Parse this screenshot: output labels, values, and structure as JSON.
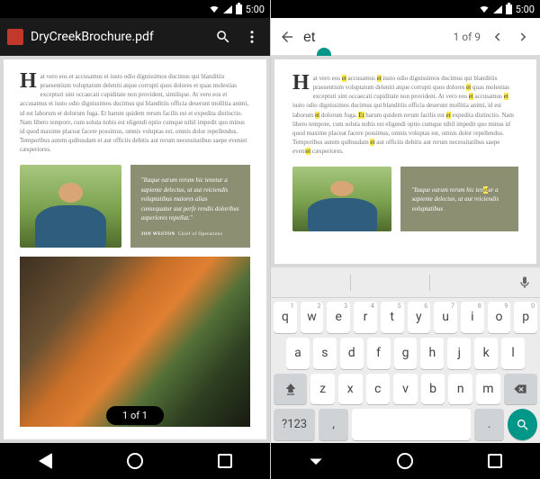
{
  "status": {
    "time": "5:00"
  },
  "left": {
    "appbar": {
      "title": "DryCreekBrochure.pdf",
      "pdf_icon_text": ""
    },
    "doc": {
      "dropcap": "H",
      "paragraph": "at vero eos et accusamus et iusto odio dignissimos ducimus qui blanditiis praesentium voluptatum deleniti atque corrupti quos dolores et quas molestias excepturi sint occaecati cupiditate non provident, similique. At vero eos et accusamus et iusto odio dignissimos ducimus qui blanditiis officia deserunt mollitia animi, id est laborum et dolorum fuga. Et harum quidem rerum facilis est et expedita distinctio. Nam libero tempore, cum soluta nobis est eligendi optio cumque nihil impedit quo minus id quod maxime placeat facere possimus, omnis voluptas est, omnis dolor repellendus. Temporibus autem quibusdam et aut officiis debitis aut rerum necessitatibus saepe eveniet cæsperiores.",
      "quote": "\"Itaque earum rerum hic tenetur a sapiente delectus, ut aut reiciendis voluptatibus maiores alias consequatur aut perfe rendis doloribus asperiores repellat.\"",
      "quote_by": "JON WESTON",
      "quote_role": "Chief of Operations"
    },
    "page_indicator": "1 of 1"
  },
  "right": {
    "search": {
      "value": "et",
      "count": "1 of 9"
    },
    "doc": {
      "dropcap": "H",
      "segments": [
        {
          "t": "at vero eos ",
          "h": false
        },
        {
          "t": "et",
          "h": true
        },
        {
          "t": " accusamus ",
          "h": false
        },
        {
          "t": "et",
          "h": true
        },
        {
          "t": " iusto odio dignissimos ducimus qui blanditiis praesentium voluptatum deleniti atque corrupti quos dolores ",
          "h": false
        },
        {
          "t": "et",
          "h": true
        },
        {
          "t": " quas molestias excepturi sint occaecati cupiditate non provident. At vero eos ",
          "h": false
        },
        {
          "t": "et",
          "h": true
        },
        {
          "t": " accusamus ",
          "h": false
        },
        {
          "t": "et",
          "h": true
        },
        {
          "t": " iusto odio dignissimos ducimus qui blanditiis officia deserunt mollitia animi, id est laborum ",
          "h": false
        },
        {
          "t": "et",
          "h": true
        },
        {
          "t": " dolorum fuga. ",
          "h": false
        },
        {
          "t": "Et",
          "h": true
        },
        {
          "t": " harum quidem rerum facilis est ",
          "h": false
        },
        {
          "t": "et",
          "h": true
        },
        {
          "t": " expedita distinctio. Nam libero tempore, cum soluta nobis est eligendi optio cumque nihil impedit quo minus id quod maxime placeat facere possimus, omnis voluptas est, omnis dolor repellendus. Temporibus autem quibusdam ",
          "h": false
        },
        {
          "t": "et",
          "h": true
        },
        {
          "t": " aut officiis debitis aut rerum necessitatibus saepe eveni",
          "h": false
        },
        {
          "t": "et",
          "h": true
        },
        {
          "t": " cæsperiores.",
          "h": false
        }
      ],
      "quote_lines": [
        "\"Itaque earum rerum hic",
        "tenetur a sapiente delectus,",
        "ut aut reiciendis voluptatibus"
      ],
      "quote_hl_index": 1
    },
    "keyboard": {
      "row1": [
        {
          "k": "q",
          "h": "1"
        },
        {
          "k": "w",
          "h": "2"
        },
        {
          "k": "e",
          "h": "3"
        },
        {
          "k": "r",
          "h": "4"
        },
        {
          "k": "t",
          "h": "5"
        },
        {
          "k": "y",
          "h": "6"
        },
        {
          "k": "u",
          "h": "7"
        },
        {
          "k": "i",
          "h": "8"
        },
        {
          "k": "o",
          "h": "9"
        },
        {
          "k": "p",
          "h": "0"
        }
      ],
      "row2": [
        "a",
        "s",
        "d",
        "f",
        "g",
        "h",
        "j",
        "k",
        "l"
      ],
      "row3": [
        "z",
        "x",
        "c",
        "v",
        "b",
        "n",
        "m"
      ],
      "sym_label": "?123",
      "period": "."
    }
  }
}
